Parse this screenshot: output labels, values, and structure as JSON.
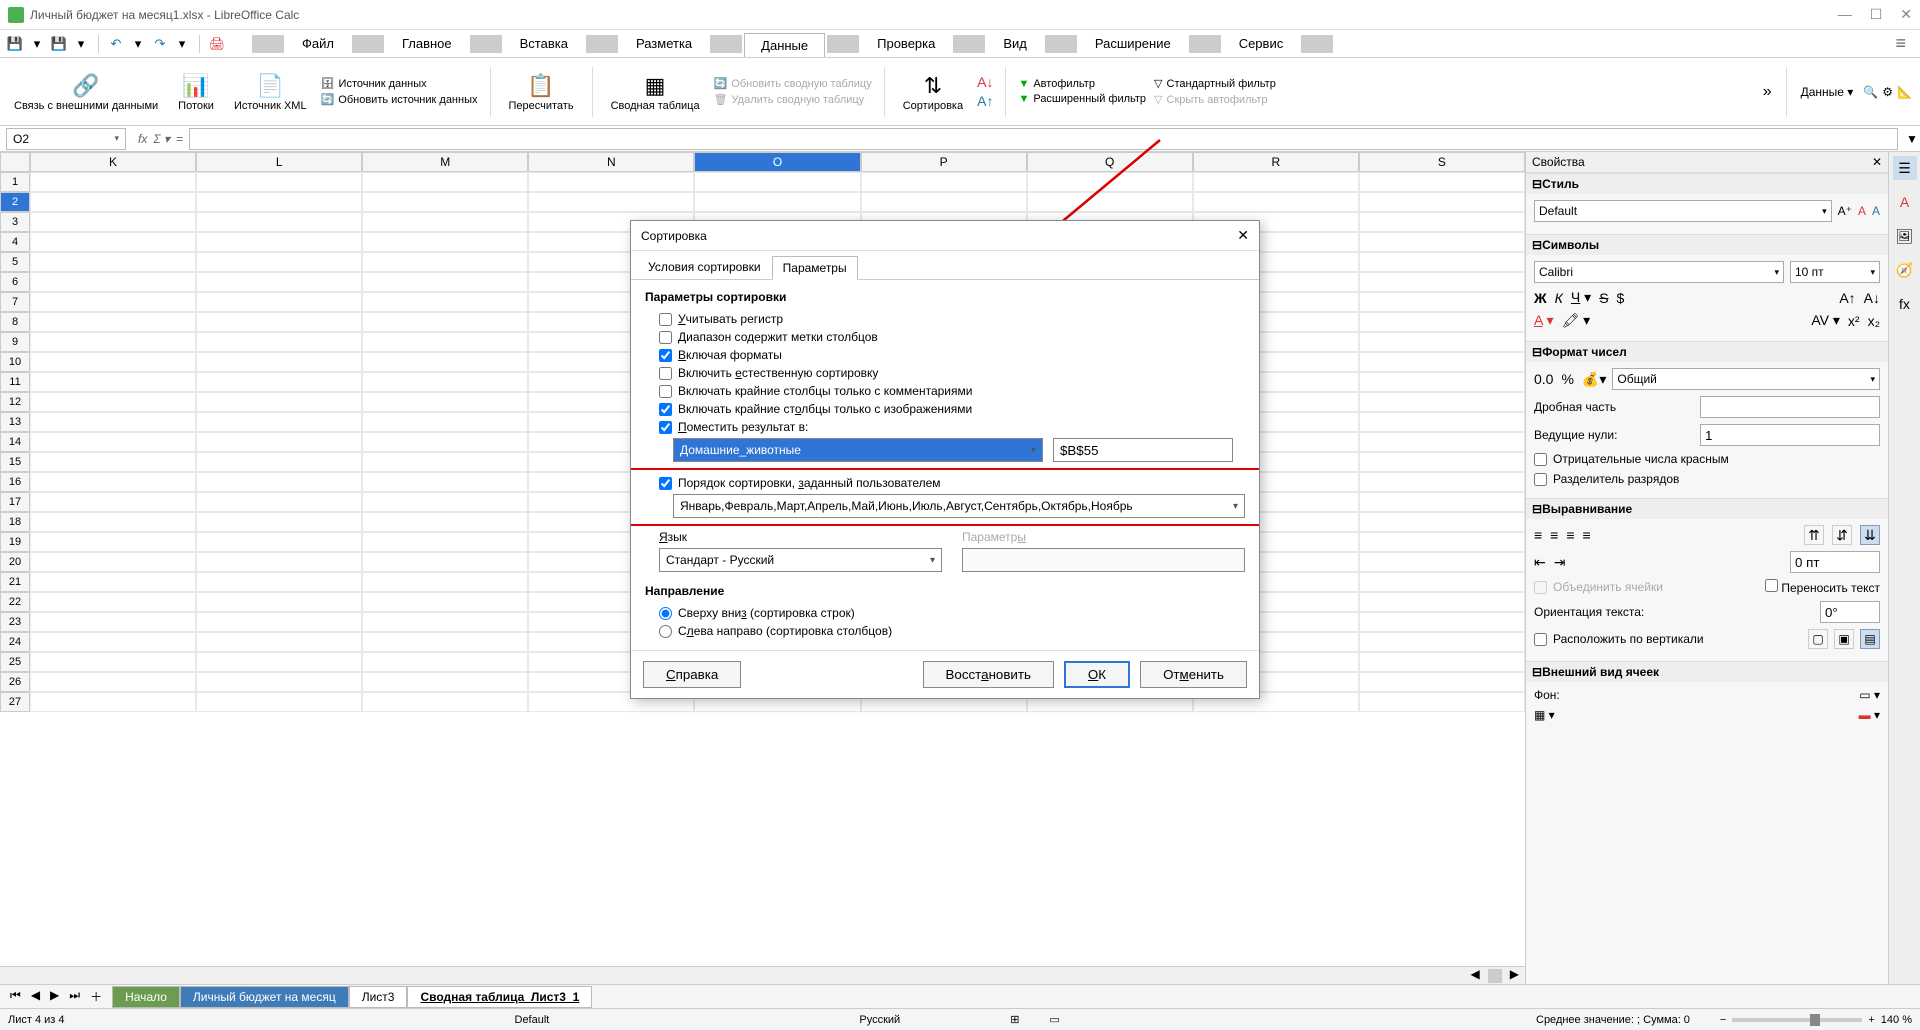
{
  "window": {
    "title": "Личный бюджет на месяц1.xlsx - LibreOffice Calc"
  },
  "menubar": {
    "items": [
      "Файл",
      "Главное",
      "Вставка",
      "Разметка",
      "Данные",
      "Проверка",
      "Вид",
      "Расширение",
      "Сервис"
    ],
    "active": "Данные"
  },
  "ribbon": {
    "external_link": "Связь с внешними данными",
    "streams": "Потоки",
    "xml_source": "Источник XML",
    "data_source": "Источник данных",
    "refresh_source": "Обновить источник данных",
    "recalc": "Пересчитать",
    "pivot": "Сводная таблица",
    "refresh_pivot": "Обновить сводную таблицу",
    "delete_pivot": "Удалить сводную таблицу",
    "sort": "Сортировка",
    "autofilter": "Автофильтр",
    "adv_filter": "Расширенный фильтр",
    "std_filter": "Стандартный фильтр",
    "hide_autofilter": "Скрыть автофильтр",
    "data_menu": "Данные"
  },
  "formula": {
    "cell_ref": "O2"
  },
  "columns": [
    "K",
    "L",
    "M",
    "N",
    "O",
    "P",
    "Q",
    "R",
    "S"
  ],
  "active_col": "O",
  "active_row": 2,
  "sidebar": {
    "title": "Свойства",
    "style": {
      "label": "Стиль",
      "value": "Default"
    },
    "symbols": {
      "label": "Символы",
      "font": "Calibri",
      "size": "10 пт"
    },
    "number_format": {
      "label": "Формат чисел",
      "value": "Общий",
      "frac_label": "Дробная часть",
      "frac_value": "",
      "lead_label": "Ведущие нули:",
      "lead_value": "1",
      "neg_red": "Отрицательные числа красным",
      "thou_sep": "Разделитель разрядов"
    },
    "alignment": {
      "label": "Выравнивание",
      "merge": "Объединить ячейки",
      "wrap": "Переносить текст",
      "indent_value": "0 пт",
      "orient_label": "Ориентация текста:",
      "orient_value": "0°",
      "vertical": "Расположить по вертикали"
    },
    "cell_appearance": {
      "label": "Внешний вид ячеек",
      "bg_label": "Фон:"
    }
  },
  "tabs": {
    "sheets": [
      "Начало",
      "Личный бюджет на месяц",
      "Лист3",
      "Сводная таблица_Лист3_1"
    ],
    "active": "Сводная таблица_Лист3_1"
  },
  "status": {
    "sheet_info": "Лист 4 из 4",
    "style": "Default",
    "lang": "Русский",
    "aggregate": "Среднее значение: ; Сумма: 0",
    "zoom": "140 %"
  },
  "dialog": {
    "title": "Сортировка",
    "tab1": "Условия сортировки",
    "tab2": "Параметры",
    "section1": "Параметры сортировки",
    "case_sensitive": "Учитывать регистр",
    "has_headers": "Диапазон содержит метки столбцов",
    "include_formats": "Включая форматы",
    "natural_sort": "Включить естественную сортировку",
    "comments_only": "Включать крайние столбцы только с комментариями",
    "images_only": "Включать крайние столбцы только с изображениями",
    "copy_to": "Поместить результат в:",
    "copy_target_name": "Домашние_животные",
    "copy_target_ref": "$B$55",
    "custom_order": "Порядок сортировки, заданный пользователем",
    "custom_list": "Январь,Февраль,Март,Апрель,Май,Июнь,Июль,Август,Сентябрь,Октябрь,Ноябрь",
    "lang_label": "Язык",
    "lang_value": "Стандарт - Русский",
    "params_label": "Параметры",
    "direction_label": "Направление",
    "dir_rows": "Сверху вниз (сортировка строк)",
    "dir_cols": "Слева направо (сортировка столбцов)",
    "help": "Справка",
    "restore": "Восстановить",
    "ok": "OК",
    "cancel": "Отменить"
  }
}
